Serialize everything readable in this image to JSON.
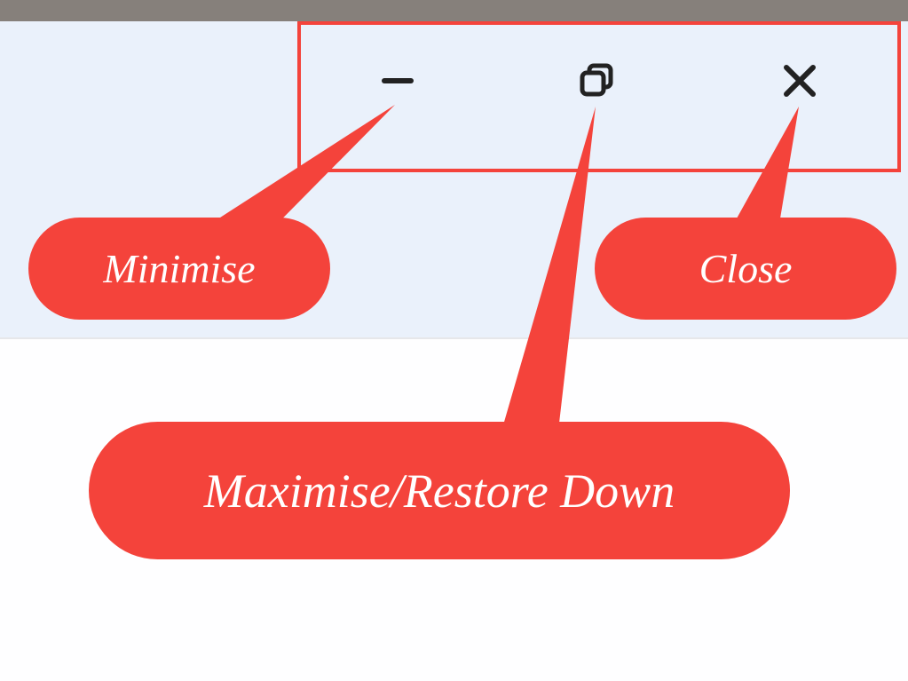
{
  "window_controls": {
    "minimise_name": "minimise-icon",
    "restore_name": "restore-down-icon",
    "close_name": "close-icon"
  },
  "callouts": {
    "minimise_label": "Minimise",
    "maximise_label": "Maximise/Restore Down",
    "close_label": "Close"
  },
  "colors": {
    "accent": "#f4433b",
    "titlebar": "#eaf1fb",
    "frame": "#86807b"
  }
}
